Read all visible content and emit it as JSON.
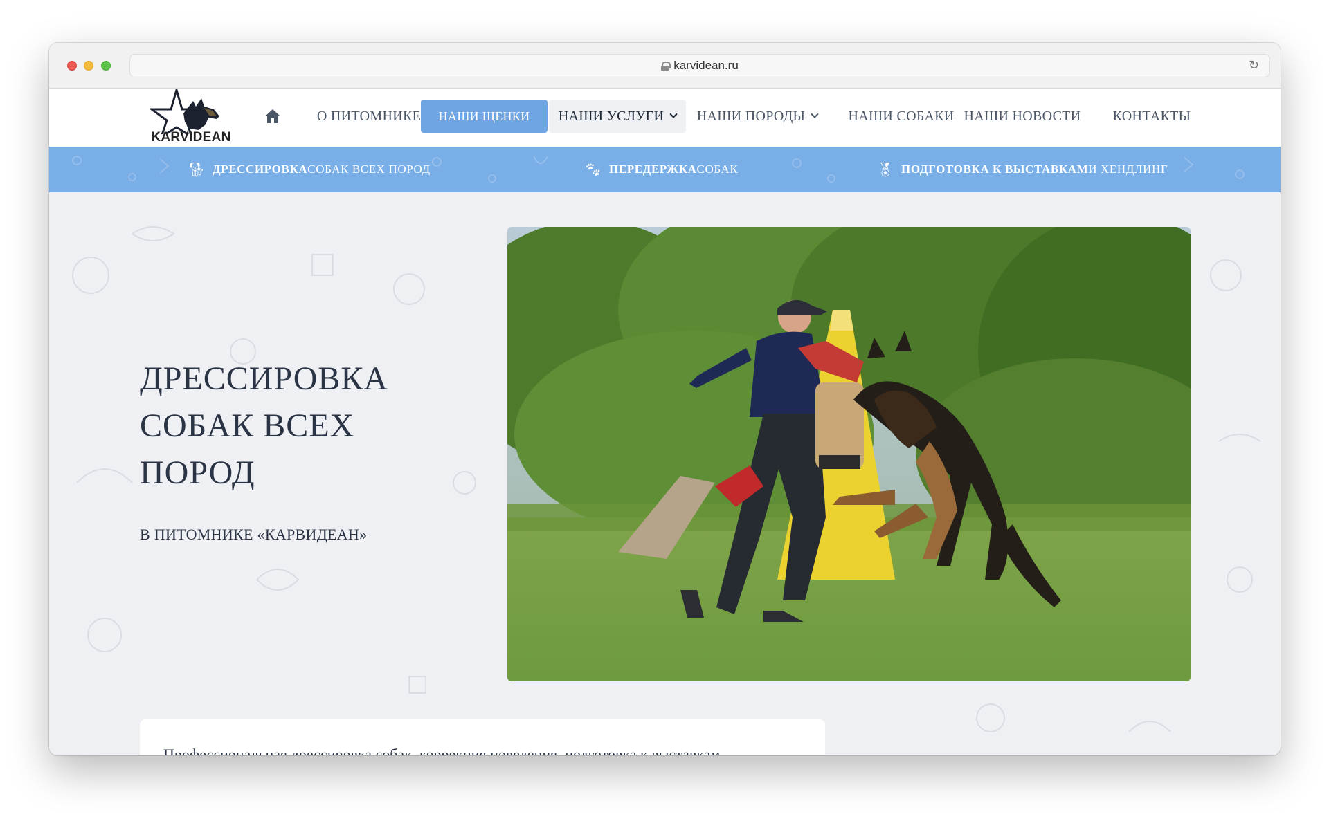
{
  "browser": {
    "url": "karvidean.ru"
  },
  "header": {
    "logo_text": "KARVIDEAN",
    "nav": {
      "about": "О ПИТОМНИКЕ",
      "puppies": "НАШИ ЩЕНКИ",
      "services": "НАШИ УСЛУГИ",
      "breeds": "НАШИ ПОРОДЫ",
      "dogs": "НАШИ СОБАКИ",
      "news": "НАШИ НОВОСТИ",
      "contacts": "КОНТАКТЫ"
    }
  },
  "strip": {
    "items": [
      {
        "icon": "dog-icon",
        "bold": "ДРЕССИРОВКА",
        "rest": " СОБАК ВСЕХ ПОРОД"
      },
      {
        "icon": "paw-icon",
        "bold": "ПЕРЕДЕРЖКА",
        "rest": " СОБАК"
      },
      {
        "icon": "medal-icon",
        "bold": "ПОДГОТОВКА К ВЫСТАВКАМ",
        "rest": " И ХЕНДЛИНГ"
      }
    ]
  },
  "hero": {
    "title_lines": [
      "ДРЕССИРОВКА",
      "СОБАК ВСЕХ",
      "ПОРОД"
    ],
    "subtitle": "В ПИТОМНИКЕ «КАРВИДЕАН»",
    "card_text": "Профессиональная дрессировка собак, коррекция поведения, подготовка к выставкам"
  },
  "colors": {
    "accent": "#6fa5e2",
    "strip": "#7aaee6",
    "text": "#2b3445",
    "hero_bg": "#eef0f3"
  }
}
